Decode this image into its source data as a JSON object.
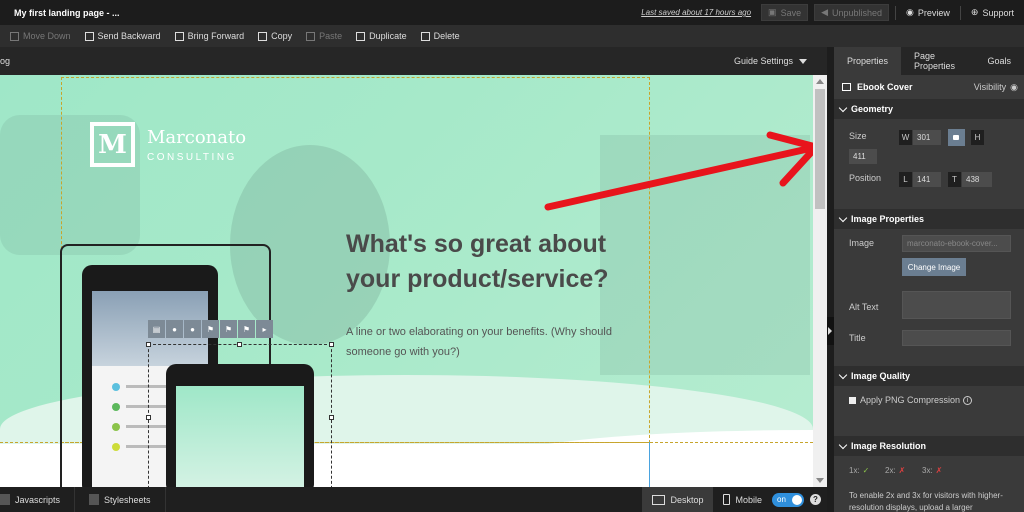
{
  "topbar": {
    "page_title": "My first landing page - ...",
    "last_saved": "Last saved about 17 hours ago",
    "save_label": "Save",
    "unpublished_label": "Unpublished",
    "preview_label": "Preview",
    "support_label": "Support"
  },
  "toolbar": {
    "move_down": "Move Down",
    "send_backward": "Send Backward",
    "bring_forward": "Bring Forward",
    "copy": "Copy",
    "paste": "Paste",
    "duplicate": "Duplicate",
    "delete": "Delete"
  },
  "guidebar": {
    "left_text": "og",
    "guide_settings": "Guide Settings"
  },
  "canvas": {
    "logo_letter": "M",
    "logo_line1": "Marconato",
    "logo_line2": "CONSULTING",
    "headline": "What's so great about your product/service?",
    "subtext": "A line or two elaborating on your benefits. (Why should someone go with you?)"
  },
  "panel": {
    "tabs": [
      {
        "label": "Properties"
      },
      {
        "label": "Page Properties"
      },
      {
        "label": "Goals"
      }
    ],
    "selected_element": "Ebook Cover",
    "visibility_label": "Visibility",
    "geometry": {
      "title": "Geometry",
      "size_label": "Size",
      "w_label": "W",
      "w_value": "301",
      "h_label": "H",
      "h_value": "411",
      "position_label": "Position",
      "l_label": "L",
      "l_value": "141",
      "t_label": "T",
      "t_value": "438"
    },
    "image_properties": {
      "title": "Image Properties",
      "image_label": "Image",
      "image_value": "marconato-ebook-cover...",
      "change_image": "Change Image",
      "alt_text_label": "Alt Text",
      "title_label": "Title"
    },
    "image_quality": {
      "title": "Image Quality",
      "png_label": "Apply PNG Compression"
    },
    "image_resolution": {
      "title": "Image Resolution",
      "r1": "1x:",
      "r2": "2x:",
      "r3": "3x:",
      "note": "To enable 2x and 3x for visitors with higher-resolution displays, upload a larger"
    }
  },
  "bottombar": {
    "javascripts": "Javascripts",
    "stylesheets": "Stylesheets",
    "desktop": "Desktop",
    "mobile": "Mobile",
    "mobile_toggle": "on",
    "help": "?"
  },
  "colors": {
    "hero_green": "#9fe7c8",
    "annotation_red": "#e8141c",
    "accent_blue": "#2f8fdc",
    "guide_gold": "#c7a52c"
  }
}
